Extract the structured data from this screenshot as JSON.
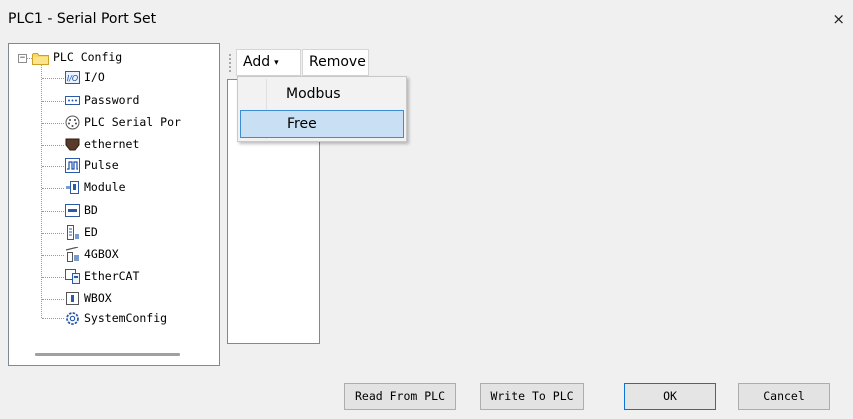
{
  "window": {
    "title": "PLC1 - Serial Port  Set",
    "close_glyph": "×"
  },
  "tree": {
    "root": {
      "label": "PLC Config",
      "expander": "−",
      "icon": "folder-icon"
    },
    "items": [
      {
        "label": "I/O",
        "icon": "io-icon"
      },
      {
        "label": "Password",
        "icon": "password-icon"
      },
      {
        "label": "PLC Serial Por",
        "icon": "serial-port-icon"
      },
      {
        "label": "ethernet",
        "icon": "ethernet-icon"
      },
      {
        "label": "Pulse",
        "icon": "pulse-icon"
      },
      {
        "label": "Module",
        "icon": "module-icon"
      },
      {
        "label": "BD",
        "icon": "bd-icon"
      },
      {
        "label": "ED",
        "icon": "ed-icon"
      },
      {
        "label": "4GBOX",
        "icon": "4gbox-icon"
      },
      {
        "label": "EtherCAT",
        "icon": "ethercat-icon"
      },
      {
        "label": "WBOX",
        "icon": "wbox-icon"
      },
      {
        "label": "SystemConfig",
        "icon": "system-config-icon"
      }
    ]
  },
  "toolbar": {
    "add_label": "Add",
    "add_caret": "▾",
    "remove_label": "Remove"
  },
  "add_menu": {
    "items": [
      "Modbus",
      "Free"
    ],
    "selected": "Free"
  },
  "buttons": {
    "read": "Read From PLC",
    "write": "Write To PLC",
    "ok": "OK",
    "cancel": "Cancel"
  },
  "colors": {
    "selection_bg": "#c9dff4",
    "selection_border": "#3b8ed4",
    "default_button_border": "#0b73d6"
  }
}
